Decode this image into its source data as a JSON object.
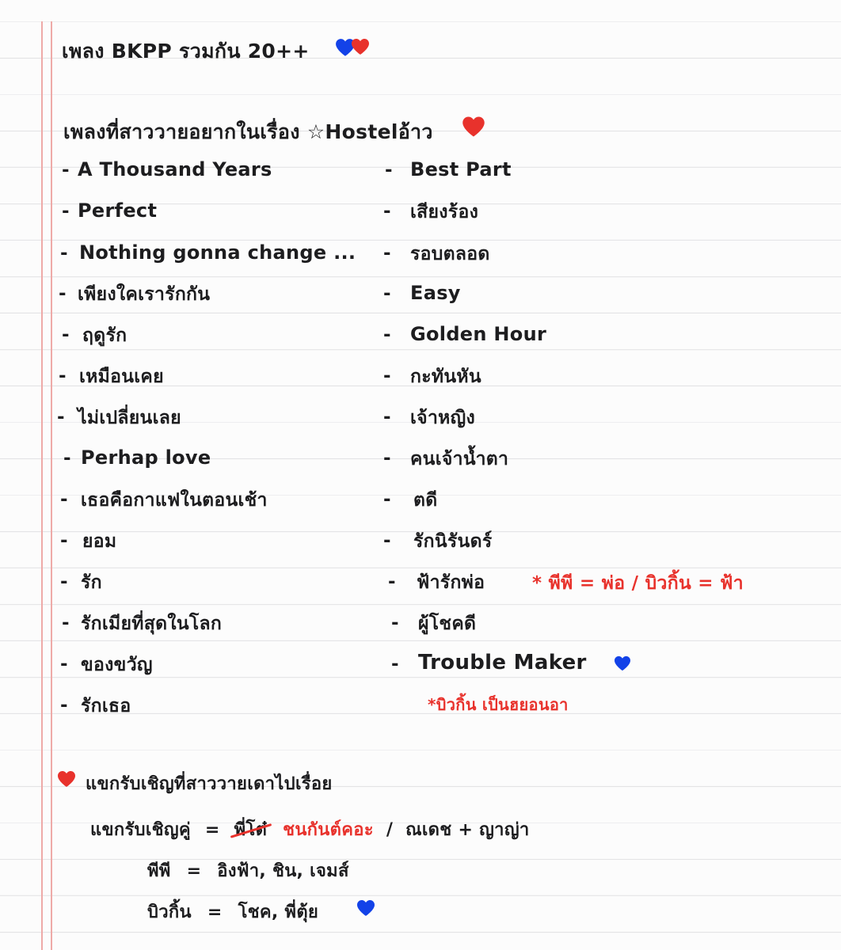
{
  "page": {
    "kind": "handwritten-note",
    "paper": {
      "background_color": "#fcfcfc",
      "rule_color": "#e3e3e5",
      "margin_line_color": "#eeaaa8",
      "rule_spacing_px": 46
    },
    "ink": {
      "black": "#1d1d1f",
      "red": "#e8322c",
      "blue": "#1342e8"
    }
  },
  "header": {
    "title": "เพลง BKPP รวมกัน 20++",
    "title_hearts": [
      "blue-heart",
      "red-heart"
    ],
    "subtitle": "เพลงที่สาววายอยากในเรื่อง ☆Hostelอ้าว",
    "subtitle_heart": "red-heart"
  },
  "songs": {
    "left_column": [
      "A Thousand Years",
      "Perfect",
      "Nothing gonna change ...",
      "เพียงใคเรารักกัน",
      "ฤดูรัก",
      "เหมือนเคย",
      "ไม่เปลี่ยนเลย",
      "Perhap love",
      "เธอคือกาแฟในตอนเช้า",
      "ยอม",
      "รัก",
      "รักเมียที่สุดในโลก",
      "ของขวัญ",
      "รักเธอ"
    ],
    "right_column": [
      "Best Part",
      "เสียงร้อง",
      "รอบตลอด",
      "Easy",
      "Golden Hour",
      "กะทันหัน",
      "เจ้าหญิง",
      "คนเจ้าน้ำตา",
      "ตดี",
      "รักนิรันดร์",
      "ฟ้ารักพ่อ",
      "ผู้โชคดี",
      "Trouble Maker"
    ],
    "bullet": "-"
  },
  "annotations": {
    "pp_equals_pho": "* พีพี = พ่อ / บิวกิ้น = ฟ้า",
    "billkin_hyuna": "*บิวกิ้น เป็นฮยอนอา",
    "trouble_maker_heart": "blue-heart"
  },
  "footer": {
    "heading": "แขกรับเชิญที่สาววายเดาไปเรื่อย",
    "heading_heart": "red-heart",
    "guest_line": {
      "label": "แขกรับเชิญคู่",
      "equals": "=",
      "struck_name": "พี่โต๋",
      "red_name": "ชนกันต์คอะ",
      "slash": "/",
      "rest": "ณเดช + ญาญ่า"
    },
    "pp_line": {
      "label": "พีพี",
      "equals": "=",
      "value": "อิงฟ้า, ชิน, เจมส์"
    },
    "billkin_line": {
      "label": "บิวกิ้น",
      "equals": "=",
      "value": "โชค, พี่ตุ้ย",
      "heart": "blue-heart"
    }
  }
}
